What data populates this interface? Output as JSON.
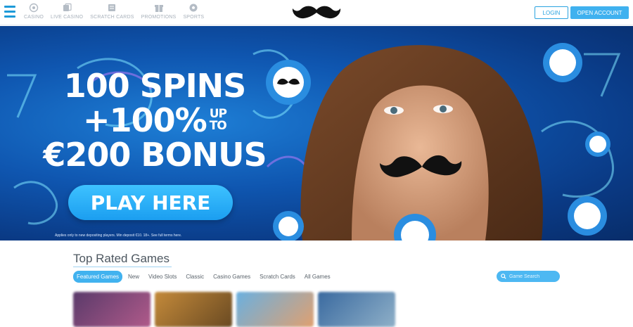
{
  "header": {
    "nav": [
      {
        "label": "CASINO",
        "icon": "casino-chip-icon"
      },
      {
        "label": "LIVE CASINO",
        "icon": "live-casino-icon"
      },
      {
        "label": "SCRATCH CARDS",
        "icon": "scratch-card-icon"
      },
      {
        "label": "PROMOTIONS",
        "icon": "gift-icon"
      },
      {
        "label": "SPORTS",
        "icon": "football-icon"
      }
    ],
    "login_label": "LOGIN",
    "open_account_label": "OPEN ACCOUNT"
  },
  "banner": {
    "line1": "100 SPINS",
    "line2": "+100%",
    "up": "UP",
    "to": "TO",
    "line3": "€200 BONUS",
    "cta_label": "PLAY HERE",
    "terms": "Applies only to new depositing players. Min deposit €10. 18+. See full terms here."
  },
  "games": {
    "title": "Top Rated Games",
    "tabs": [
      "Featured Games",
      "New",
      "Video Slots",
      "Classic",
      "Casino Games",
      "Scratch Cards",
      "All Games"
    ],
    "active_tab": "Featured Games",
    "search_placeholder": "Game Search"
  },
  "colors": {
    "accent": "#3fb1ef",
    "banner_blue": "#0f56b0"
  }
}
